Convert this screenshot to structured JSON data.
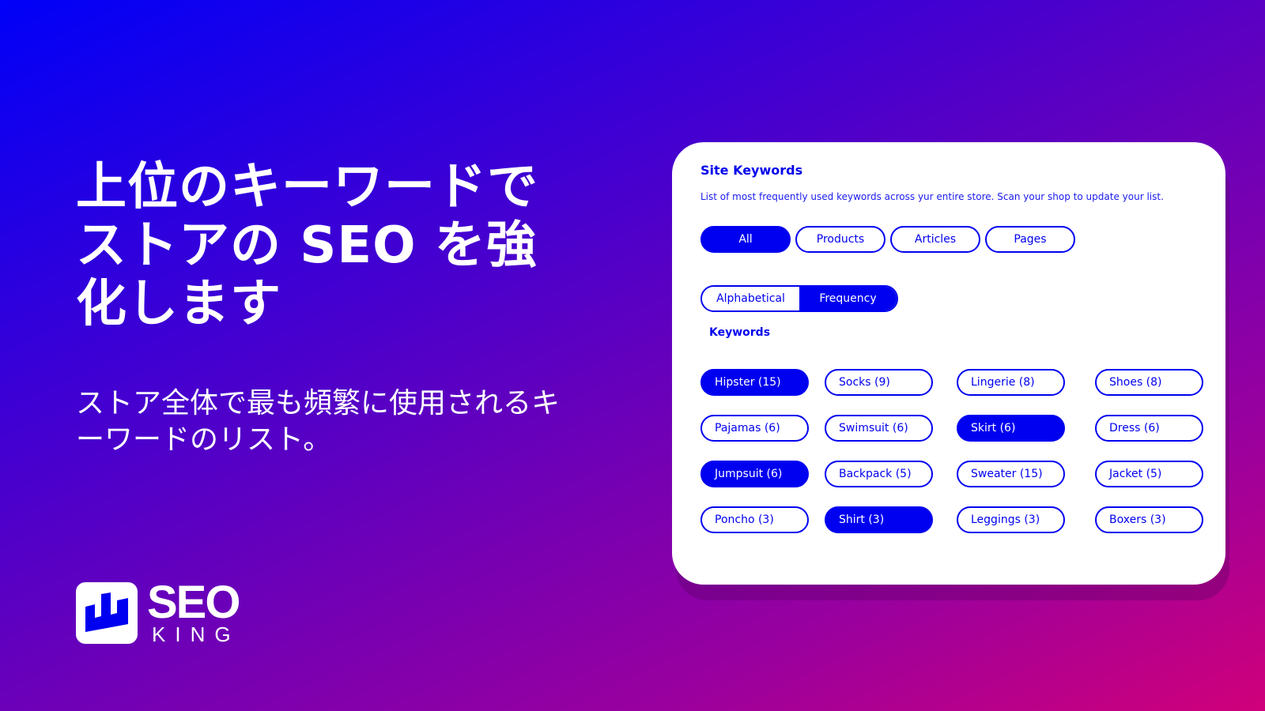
{
  "hero": {
    "title": "上位のキーワードでストアの SEO を強化します",
    "subtitle": "ストア全体で最も頻繁に使用されるキーワードのリスト。"
  },
  "logo": {
    "icon": "castle-chart-icon",
    "primary": "SEO",
    "secondary": "KING"
  },
  "colors": {
    "accent": "#0000f0",
    "background_top_left": "#0000f8",
    "background_bottom_right": "#d0007a",
    "card": "#ffffff"
  },
  "card": {
    "title": "Site Keywords",
    "description": "List of most frequently used keywords across yur entire store. Scan your shop to update your list.",
    "filter_tabs": [
      {
        "label": "All",
        "active": true
      },
      {
        "label": "Products",
        "active": false
      },
      {
        "label": "Articles",
        "active": false
      },
      {
        "label": "Pages",
        "active": false
      }
    ],
    "sort_options": [
      {
        "label": "Alphabetical",
        "active": false
      },
      {
        "label": "Frequency",
        "active": true
      }
    ],
    "keywords_label": "Keywords",
    "keywords": [
      {
        "label": "Hipster (15)",
        "selected": true
      },
      {
        "label": "Socks (9)",
        "selected": false
      },
      {
        "label": "Lingerie (8)",
        "selected": false
      },
      {
        "label": "Shoes (8)",
        "selected": false
      },
      {
        "label": "Pajamas (6)",
        "selected": false
      },
      {
        "label": "Swimsuit (6)",
        "selected": false
      },
      {
        "label": "Skirt (6)",
        "selected": true
      },
      {
        "label": "Dress (6)",
        "selected": false
      },
      {
        "label": "Jumpsuit (6)",
        "selected": true
      },
      {
        "label": "Backpack (5)",
        "selected": false
      },
      {
        "label": "Sweater (15)",
        "selected": false
      },
      {
        "label": "Jacket (5)",
        "selected": false
      },
      {
        "label": "Poncho (3)",
        "selected": false
      },
      {
        "label": "Shirt (3)",
        "selected": true
      },
      {
        "label": "Leggings (3)",
        "selected": false
      },
      {
        "label": "Boxers (3)",
        "selected": false
      }
    ]
  }
}
